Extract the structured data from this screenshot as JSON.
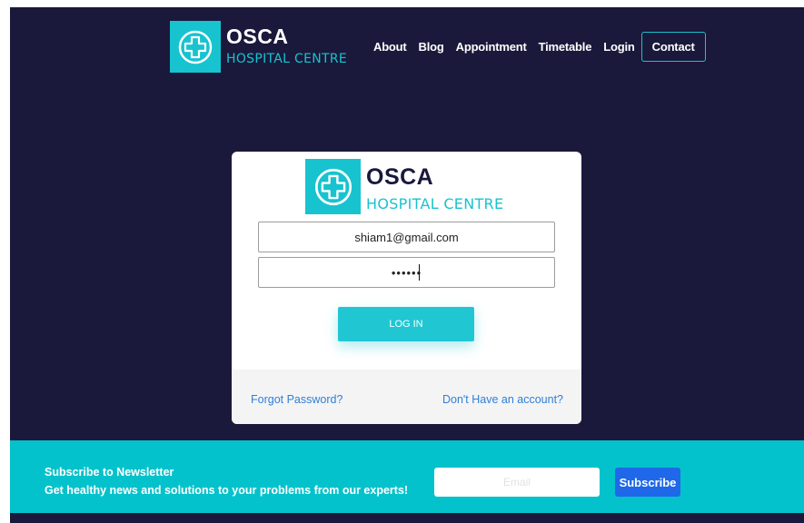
{
  "header": {
    "logo": {
      "brand": "OSCA",
      "subtitle": "HOSPITAL CENTRE",
      "icon": "medical-cross-icon"
    },
    "nav": [
      {
        "label": "About"
      },
      {
        "label": "Blog"
      },
      {
        "label": "Appointment"
      },
      {
        "label": "Timetable"
      },
      {
        "label": "Login"
      },
      {
        "label": "Contact"
      }
    ]
  },
  "login": {
    "logo": {
      "brand": "OSCA",
      "subtitle": "HOSPITAL CENTRE",
      "icon": "medical-cross-icon"
    },
    "email_value": "shiam1@gmail.com",
    "password_value": "••••••",
    "submit_label": "LOG IN",
    "forgot_label": "Forgot Password?",
    "signup_label": "Don't Have an account?"
  },
  "newsletter": {
    "title": "Subscribe to Newsletter",
    "text": "Get healthy news and solutions to your problems from our experts!",
    "email_placeholder": "Email",
    "button_label": "Subscribe"
  },
  "colors": {
    "background": "#1a193b",
    "accent": "#17c3cf",
    "newsletter_bg": "#04c2cb",
    "link": "#2f7fd8",
    "subscribe_button": "#1e68e9"
  }
}
